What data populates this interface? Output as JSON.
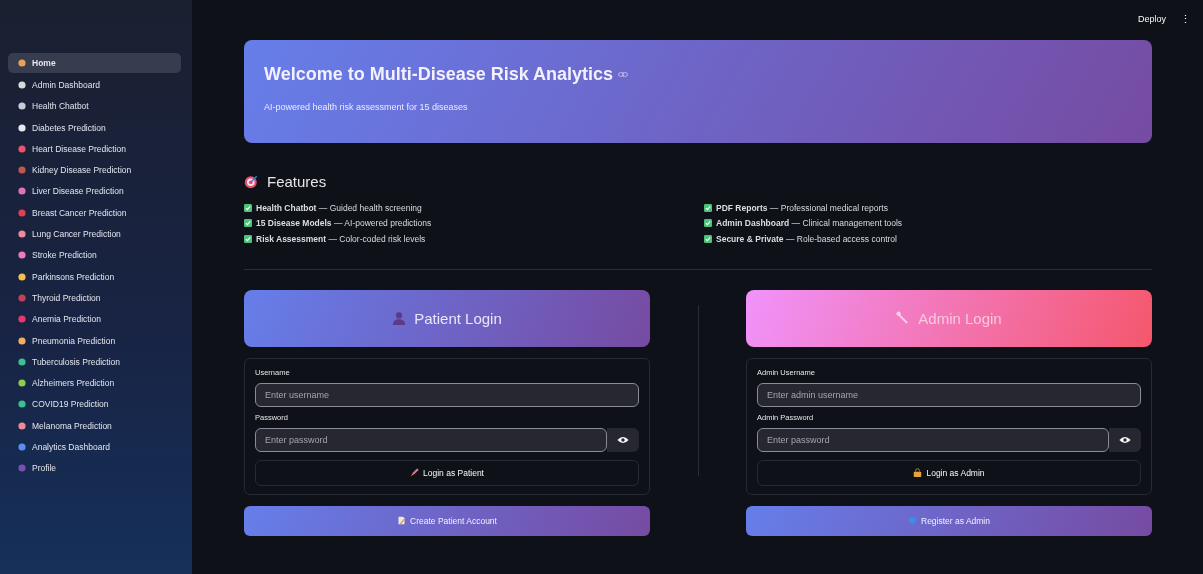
{
  "top_bar": {
    "deploy": "Deploy",
    "menu": "⋮"
  },
  "sidebar": {
    "items": [
      {
        "label": "Home",
        "selected": true,
        "color": "#e8a25a"
      },
      {
        "label": "Admin Dashboard",
        "selected": false,
        "color": "#d9d9d9"
      },
      {
        "label": "Health Chatbot",
        "selected": false,
        "color": "#c9ccd6"
      },
      {
        "label": "Diabetes Prediction",
        "selected": false,
        "color": "#e6e9f0"
      },
      {
        "label": "Heart Disease Prediction",
        "selected": false,
        "color": "#f0506e"
      },
      {
        "label": "Kidney Disease Prediction",
        "selected": false,
        "color": "#c0574f"
      },
      {
        "label": "Liver Disease Prediction",
        "selected": false,
        "color": "#e073b8"
      },
      {
        "label": "Breast Cancer Prediction",
        "selected": false,
        "color": "#e0404f"
      },
      {
        "label": "Lung Cancer Prediction",
        "selected": false,
        "color": "#f08a9a"
      },
      {
        "label": "Stroke Prediction",
        "selected": false,
        "color": "#f07ab8"
      },
      {
        "label": "Parkinsons Prediction",
        "selected": false,
        "color": "#f5c04a"
      },
      {
        "label": "Thyroid Prediction",
        "selected": false,
        "color": "#c2405a"
      },
      {
        "label": "Anemia Prediction",
        "selected": false,
        "color": "#e83a6a"
      },
      {
        "label": "Pneumonia Prediction",
        "selected": false,
        "color": "#f0b060"
      },
      {
        "label": "Tuberculosis Prediction",
        "selected": false,
        "color": "#3fbf8f"
      },
      {
        "label": "Alzheimers Prediction",
        "selected": false,
        "color": "#8fcf4f"
      },
      {
        "label": "COVID19 Prediction",
        "selected": false,
        "color": "#3fbf8f"
      },
      {
        "label": "Melanoma Prediction",
        "selected": false,
        "color": "#f08a9a"
      },
      {
        "label": "Analytics Dashboard",
        "selected": false,
        "color": "#5a8ef0"
      },
      {
        "label": "Profile",
        "selected": false,
        "color": "#7a4fb0"
      }
    ]
  },
  "hero": {
    "title": "Welcome to Multi-Disease Risk Analytics",
    "subtitle": "AI-powered health risk assessment for 15 diseases"
  },
  "features": {
    "heading": "Features",
    "items": [
      {
        "text": "**Health Chatbot** — Guided health screening",
        "checked": true
      },
      {
        "text": "**15 Disease Models** — AI-powered predictions",
        "checked": true
      },
      {
        "text": "**Risk Assessment** — Color-coded risk levels",
        "checked": true
      },
      {
        "text": "**PDF Reports** — Professional medical reports",
        "checked": true
      },
      {
        "text": "**Admin Dashboard** — Clinical management tools",
        "checked": true
      },
      {
        "text": "**Secure & Private** — Role-based access control",
        "checked": true
      }
    ]
  },
  "logins": [
    {
      "kind": "patient",
      "title": "Patient Login",
      "fields": [
        {
          "kind": "text",
          "label": "Username",
          "placeholder": "Enter username"
        },
        {
          "kind": "password",
          "label": "Password",
          "placeholder": "Enter password"
        }
      ],
      "submit": "Login as Patient",
      "secondary": "Create Patient Account"
    },
    {
      "kind": "admin",
      "title": "Admin Login",
      "fields": [
        {
          "kind": "text",
          "label": "Admin Username",
          "placeholder": "Enter admin username"
        },
        {
          "kind": "password",
          "label": "Admin Password",
          "placeholder": "Enter password"
        }
      ],
      "submit": "Login as Admin",
      "secondary": "Register as Admin"
    }
  ]
}
